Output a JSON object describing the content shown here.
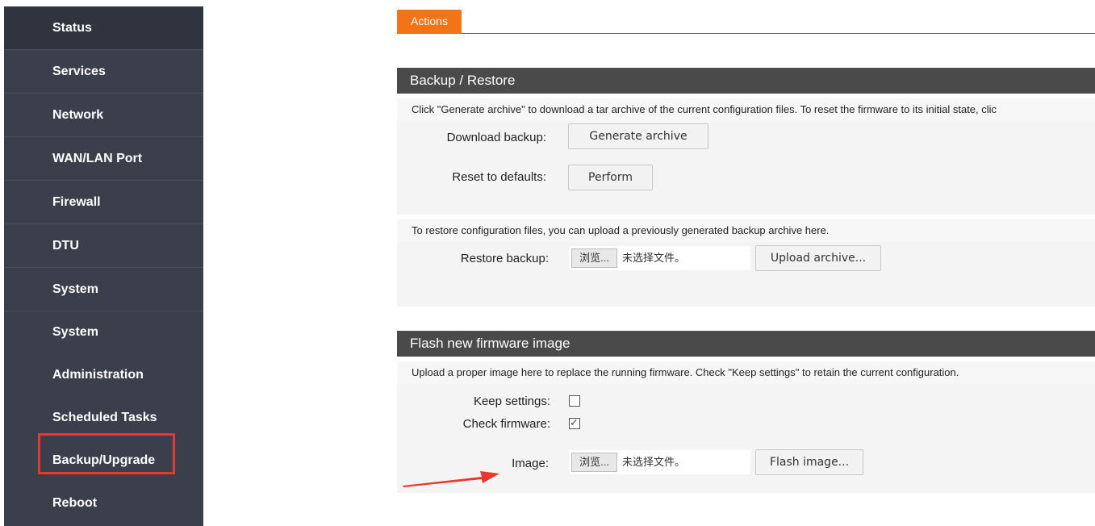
{
  "sidebar": {
    "items": [
      {
        "label": "Status"
      },
      {
        "label": "Services"
      },
      {
        "label": "Network"
      },
      {
        "label": "WAN/LAN Port"
      },
      {
        "label": "Firewall"
      },
      {
        "label": "DTU"
      },
      {
        "label": "System"
      }
    ],
    "sub_items": [
      {
        "label": "System"
      },
      {
        "label": "Administration"
      },
      {
        "label": "Scheduled Tasks"
      },
      {
        "label": "Backup/Upgrade"
      },
      {
        "label": "Reboot"
      }
    ],
    "highlighted_item": "Backup/Upgrade"
  },
  "tabs": {
    "actions_label": "Actions"
  },
  "backup": {
    "title": "Backup / Restore",
    "description": "Click \"Generate archive\" to download a tar archive of the current configuration files. To reset the firmware to its initial state, clic",
    "download_label": "Download backup:",
    "generate_button": "Generate archive",
    "reset_label": "Reset to defaults:",
    "perform_button": "Perform",
    "restore_description": "To restore configuration files, you can upload a previously generated backup archive here.",
    "restore_label": "Restore backup:",
    "browse_button": "浏览...",
    "no_file_text": "未选择文件。",
    "upload_button": "Upload archive..."
  },
  "flash": {
    "title": "Flash new firmware image",
    "description": "Upload a proper image here to replace the running firmware. Check \"Keep settings\" to retain the current configuration.",
    "keep_label": "Keep settings:",
    "keep_checked": false,
    "check_label": "Check firmware:",
    "check_checked": true,
    "image_label": "Image:",
    "browse_button": "浏览...",
    "no_file_text": "未选择文件。",
    "flash_button": "Flash image..."
  },
  "colors": {
    "sidebar_bg": "#3a3f4b",
    "tab_active": "#f47315",
    "section_header": "#4a4a4a",
    "annotation_red": "#e8372c",
    "tab_underline": "#2f6bd0"
  }
}
